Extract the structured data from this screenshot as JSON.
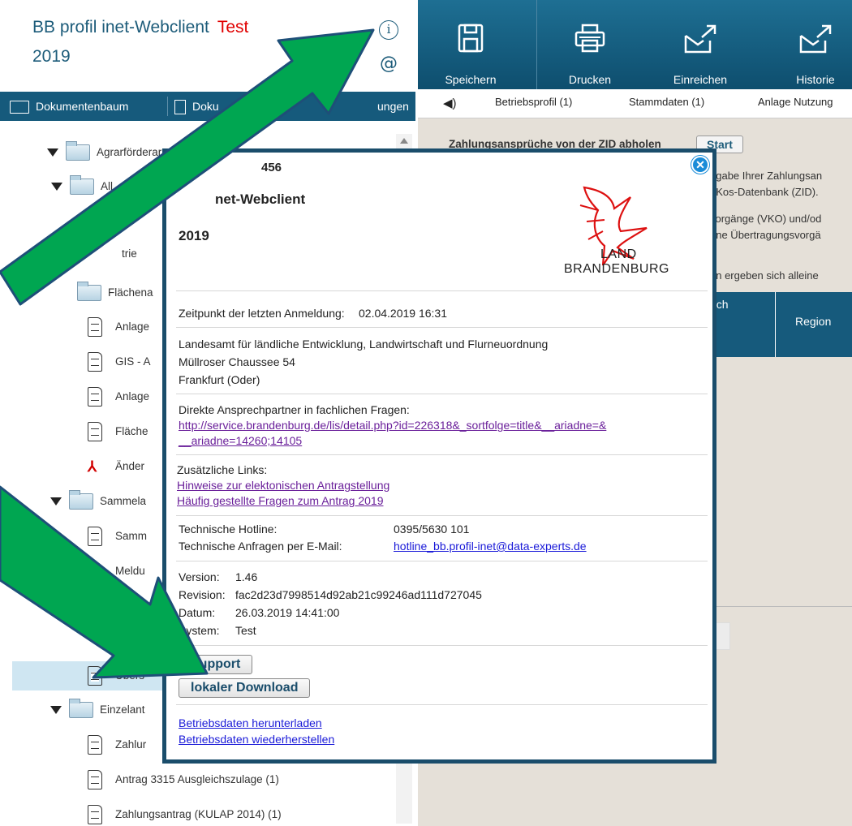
{
  "app": {
    "title": "BB profil inet-Webclient",
    "test_label": "Test",
    "year": "2019",
    "info_icon": "i",
    "at_icon": "@"
  },
  "left_toolbar": {
    "items": [
      "Dokumentenbaum",
      "Doku",
      "ungen"
    ]
  },
  "tree": {
    "rows": [
      {
        "label": "Agrarförderar"
      },
      {
        "label": "All"
      },
      {
        "label": "trie"
      },
      {
        "label": "Flächena"
      },
      {
        "label": "Anlage"
      },
      {
        "label": "GIS - A"
      },
      {
        "label": "Anlage"
      },
      {
        "label": "Fläche"
      },
      {
        "label": "Änder"
      },
      {
        "label": "Sammela"
      },
      {
        "label": "Samm"
      },
      {
        "label": "Meldu"
      },
      {
        "label": "Übers"
      },
      {
        "label": "Einzelant"
      },
      {
        "label": "Zahlur"
      },
      {
        "label": "Antrag 3315 Ausgleichszulage (1)"
      },
      {
        "label": "Zahlungsantrag (KULAP 2014) (1)"
      }
    ]
  },
  "top_toolbar": {
    "buttons": [
      {
        "label": "Speichern",
        "icon": "save-icon"
      },
      {
        "label": "Drucken",
        "icon": "printer-icon"
      },
      {
        "label": "Einreichen",
        "icon": "send-icon"
      },
      {
        "label": "Historie",
        "icon": "send-icon"
      }
    ]
  },
  "tabs": {
    "speaker": "◀)",
    "items": [
      "Betriebsprofil (1)",
      "Stammdaten (1)",
      "Anlage Nutzung"
    ]
  },
  "content": {
    "zid_label": "Zahlungsansprüche von der ZID abholen",
    "start_button": "Start",
    "line1": "ngabe Ihrer Zahlungsan",
    "line2": "eKos-Datenbank (ZID).",
    "line3": "vorgänge (VKO) und/od",
    "line4": "ene Übertragungsvorgä",
    "line5": "en ergeben sich alleine",
    "grid_col1": "uch",
    "grid_col2": "Region"
  },
  "dialog": {
    "close": "✕",
    "title_a": "456",
    "title_b": "net-Webclient",
    "year": "2019",
    "logo_line1": "LAND",
    "logo_line2": "BRANDENBURG",
    "last_login_label": "Zeitpunkt der letzten Anmeldung:",
    "last_login_value": "02.04.2019 16:31",
    "org_name": "Landesamt für ländliche Entwicklung, Landwirtschaft und Flurneuordnung",
    "org_street": "Müllroser Chaussee 54",
    "org_city": "Frankfurt (Oder)",
    "contact_label": "Direkte Ansprechpartner in fachlichen Fragen:",
    "contact_link_1": "http://service.brandenburg.de/lis/detail.php?id=226318&_sortfolge=title&__ariadne=&",
    "contact_link_2": "__ariadne=14260;14105",
    "links_label": "Zusätzliche Links:",
    "link_hints": "Hinweise zur elektonischen Antragstellung",
    "link_faq": "Häufig gestellte Fragen zum Antrag 2019",
    "hotline_label": "Technische Hotline:",
    "hotline_value": "0395/5630 101",
    "email_label": "Technische Anfragen per E-Mail:",
    "email_value": "hotline_bb.profil-inet@data-experts.de",
    "version_label": "Version:",
    "version_value": "1.46",
    "revision_label": "Revision:",
    "revision_value": "fac2d23d7998514d92ab21c99246ad111d727045",
    "date_label": "Datum:",
    "date_value": "26.03.2019 14:41:00",
    "system_label": "System:",
    "system_value": "Test",
    "support_button": "Support",
    "download_button": "lokaler Download",
    "link_download_data": "Betriebsdaten herunterladen",
    "link_restore_data": "Betriebsdaten wiederherstellen"
  },
  "colors": {
    "brand_dark": "#165a7c",
    "dialog_border": "#1a4d6b",
    "arrow_green": "#00a651",
    "test_red": "#e00000"
  }
}
